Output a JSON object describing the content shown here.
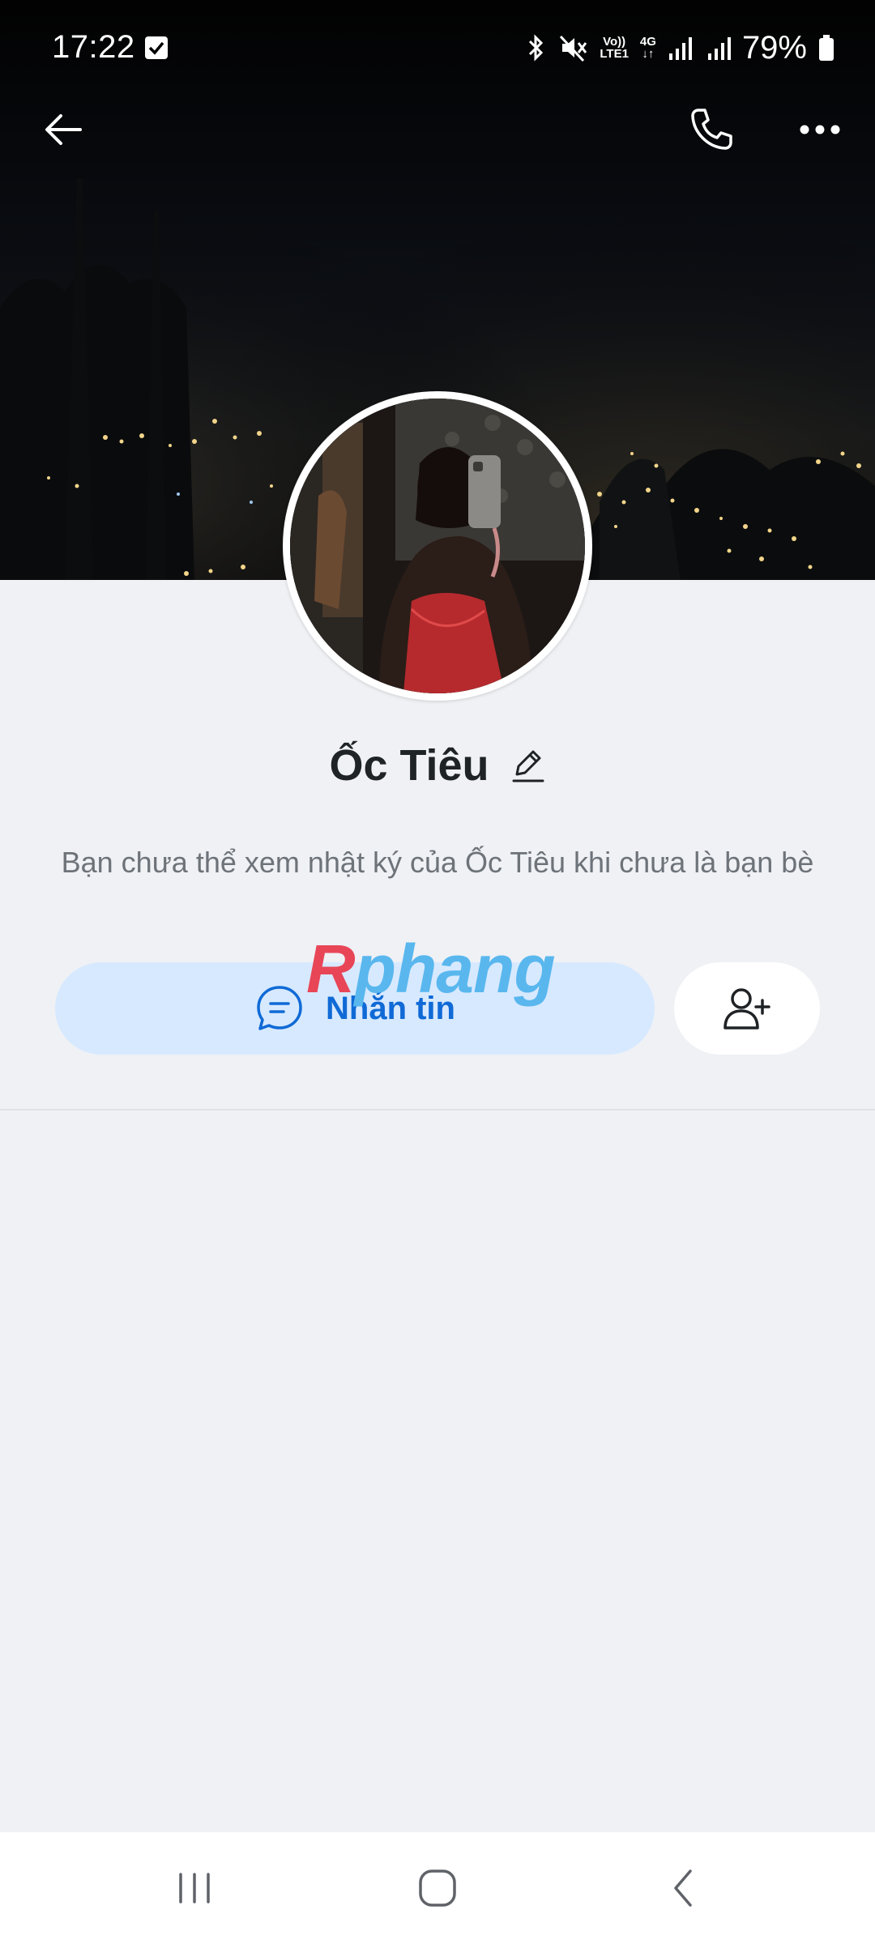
{
  "status_bar": {
    "time": "17:22",
    "battery": "79%",
    "network_top": "Vo))",
    "network_bottom": "LTE1",
    "data_type": "4G",
    "icons": [
      "check-notification-icon",
      "bluetooth-icon",
      "mute-icon",
      "volte-icon",
      "4g-data-icon",
      "signal-icon",
      "signal-icon",
      "battery-icon"
    ]
  },
  "top_nav": {
    "icons": [
      "back-arrow-icon",
      "phone-icon",
      "more-dots-icon"
    ]
  },
  "profile": {
    "name": "Ốc Tiêu",
    "notice": "Bạn chưa thể xem nhật ký của Ốc Tiêu khi chưa là bạn bè"
  },
  "actions": {
    "message_label": "Nhắn tin",
    "message_icon": "chat-bubble-icon",
    "add_friend_icon": "add-person-icon"
  },
  "watermark": {
    "part1": "R",
    "part2": "phang"
  },
  "colors": {
    "accent": "#0f6ad6",
    "message_button_bg": "#d7e9ff",
    "page_bg": "#eff1f5"
  },
  "nav_bar": {
    "icons": [
      "recent-apps-icon",
      "home-icon",
      "system-back-icon"
    ]
  }
}
